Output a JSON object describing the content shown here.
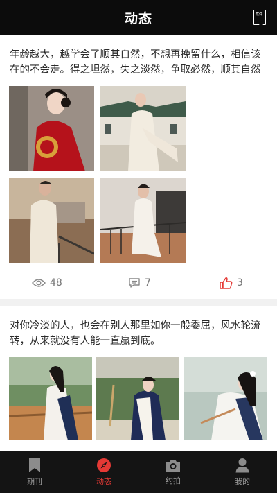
{
  "header": {
    "title": "动态",
    "book_icon_text": "案件"
  },
  "posts": [
    {
      "text": "年龄越大，越学会了顺其自然，不想再挽留什么，相信该在的不会走。得之坦然，失之淡然，争取必然，顺其自然",
      "views": "48",
      "comments": "7",
      "likes": "3"
    },
    {
      "text": "对你冷淡的人，也会在别人那里如你一般委屈，风水轮流转，从来就没有人能一直赢到底。"
    }
  ],
  "tabs": [
    {
      "label": "期刊",
      "icon": "bookmark-icon"
    },
    {
      "label": "动态",
      "icon": "compass-icon"
    },
    {
      "label": "约拍",
      "icon": "camera-icon"
    },
    {
      "label": "我的",
      "icon": "person-icon"
    }
  ],
  "colors": {
    "active": "#e53935",
    "like": "#e53935",
    "bar": "#141414"
  }
}
